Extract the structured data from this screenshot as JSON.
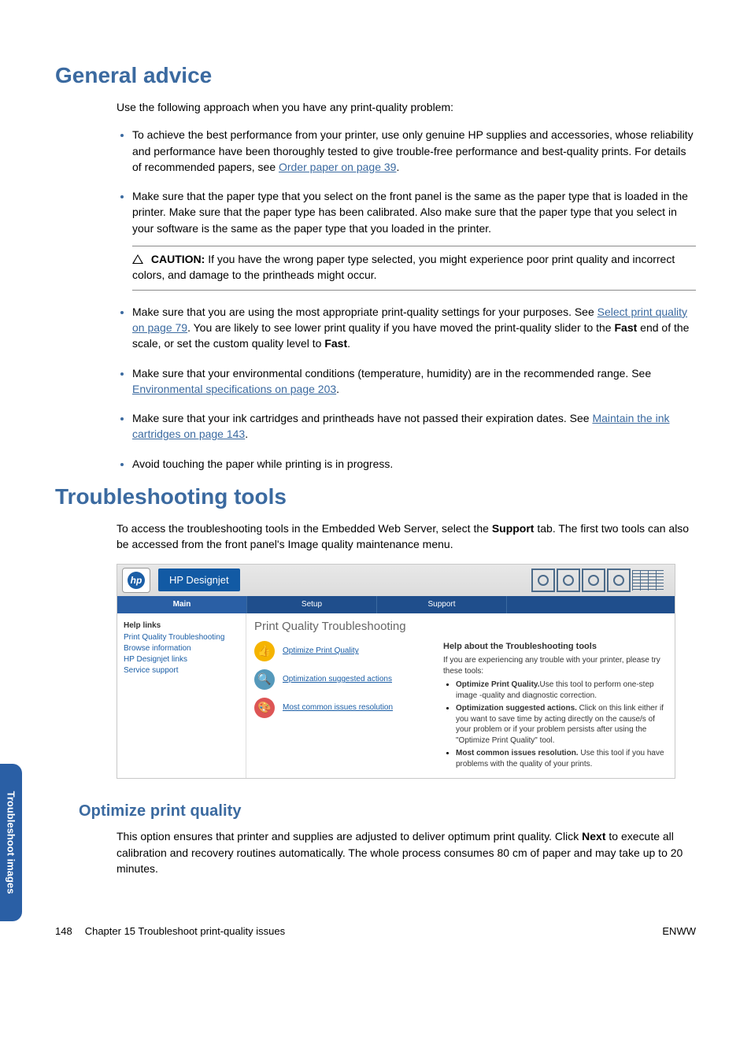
{
  "h1_general": "General advice",
  "intro1": "Use the following approach when you have any print-quality problem:",
  "bullets": {
    "b1_pre": "To achieve the best performance from your printer, use only genuine HP supplies and accessories, whose reliability and performance have been thoroughly tested to give trouble-free performance and best-quality prints. For details of recommended papers, see ",
    "b1_link": "Order paper on page 39",
    "b1_post": ".",
    "b2": "Make sure that the paper type that you select on the front panel is the same as the paper type that is loaded in the printer. Make sure that the paper type has been calibrated. Also make sure that the paper type that you select in your software is the same as the paper type that you loaded in the printer.",
    "caution_label": "CAUTION:",
    "caution_text": "If you have the wrong paper type selected, you might experience poor print quality and incorrect colors, and damage to the printheads might occur.",
    "b3a": "Make sure that you are using the most appropriate print-quality settings for your purposes. See ",
    "b3_link": "Select print quality on page 79",
    "b3b": ". You are likely to see lower print quality if you have moved the print-quality slider to the ",
    "b3_fast1": "Fast",
    "b3c": " end of the scale, or set the custom quality level to ",
    "b3_fast2": "Fast",
    "b3d": ".",
    "b4a": "Make sure that your environmental conditions (temperature, humidity) are in the recommended range. See ",
    "b4_link": "Environmental specifications on page 203",
    "b4b": ".",
    "b5a": "Make sure that your ink cartridges and printheads have not passed their expiration dates. See ",
    "b5_link": "Maintain the ink cartridges on page 143",
    "b5b": ".",
    "b6": "Avoid touching the paper while printing is in progress."
  },
  "h1_tools": "Troubleshooting tools",
  "tools_intro_a": "To access the troubleshooting tools in the Embedded Web Server, select the ",
  "tools_intro_bold": "Support",
  "tools_intro_b": " tab. The first two tools can also be accessed from the front panel's Image quality maintenance menu.",
  "ews": {
    "brand": "HP Designjet",
    "tabs": [
      "Main",
      "Setup",
      "Support"
    ],
    "sidebar": {
      "cat1": "Help links",
      "l1": "Print Quality Troubleshooting",
      "l2": "Browse information",
      "l3": "HP Designjet links",
      "l4": "Service support"
    },
    "main_title": "Print Quality Troubleshooting",
    "actions": [
      "Optimize Print Quality",
      "Optimization suggested actions",
      "Most common issues resolution"
    ],
    "help": {
      "title": "Help about the Troubleshooting tools",
      "intro": "If you are experiencing any trouble with your printer, please try these tools:",
      "i1b": "Optimize Print Quality.",
      "i1": "Use this tool to perform one-step image -quality and diagnostic correction.",
      "i2b": "Optimization suggested actions.",
      "i2": " Click on this link either if you want to save time by acting directly on the cause/s of your problem or if your problem persists after using the \"Optimize Print Quality\" tool.",
      "i3b": "Most common issues resolution.",
      "i3": " Use this tool if you have problems with the quality of your prints."
    }
  },
  "h2_opt": "Optimize print quality",
  "opt_a": "This option ensures that printer and supplies are adjusted to deliver optimum print quality. Click ",
  "opt_bold": "Next",
  "opt_b": " to execute all calibration and recovery routines automatically. The whole process consumes 80 cm of paper and may take up to 20 minutes.",
  "side_tab": "Troubleshoot images",
  "footer": {
    "page": "148",
    "chap": "Chapter 15   Troubleshoot print-quality issues",
    "lang": "ENWW"
  }
}
